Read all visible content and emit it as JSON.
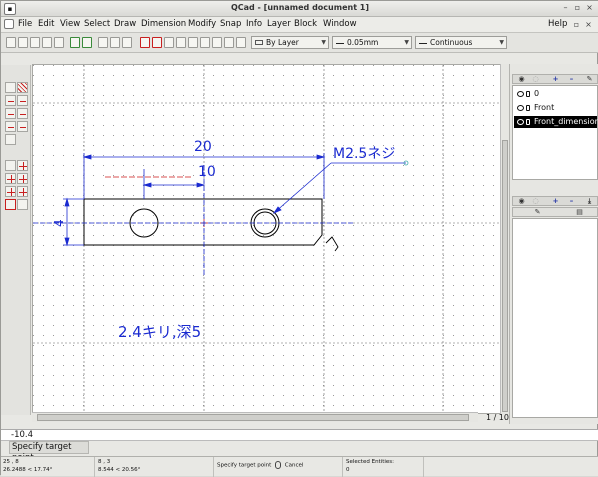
{
  "window": {
    "title": "QCad - [unnamed document 1]"
  },
  "menu": {
    "items": [
      "File",
      "Edit",
      "View",
      "Select",
      "Draw",
      "Dimension",
      "Modify",
      "Snap",
      "Info",
      "Layer",
      "Block",
      "Window"
    ],
    "help": "Help"
  },
  "toolbar": {
    "layer_combo": "By Layer",
    "width_combo": "0.05mm",
    "linetype_combo": "Continuous"
  },
  "drawing": {
    "dim_overall": "20",
    "dim_half": "10",
    "dim_height": "4",
    "thread_note": "M2.5ネジ",
    "hole_note": "2.4キリ,深5"
  },
  "page_indicator": "1 / 10",
  "layers": {
    "items": [
      {
        "name": "0",
        "selected": false
      },
      {
        "name": "Front",
        "selected": false
      },
      {
        "name": "Front_dimension",
        "selected": true
      }
    ]
  },
  "command": {
    "input_value": "-10.4",
    "message": "Specify target point"
  },
  "status": {
    "abs_coord": "25 , 8",
    "abs_polar": "26.2488 < 17.74°",
    "rel_coord": "8 , 3",
    "rel_polar": "8.544 < 20.56°",
    "left_hint": "Specify target point",
    "right_hint": "Cancel",
    "selected_label": "Selected Entities:",
    "selected_count": "0"
  },
  "colors": {
    "drawing_lines": "#000000",
    "dimensions": "#1a2ad0",
    "center_lines": "#cc1a1a",
    "grid": "#7a7a7a"
  }
}
